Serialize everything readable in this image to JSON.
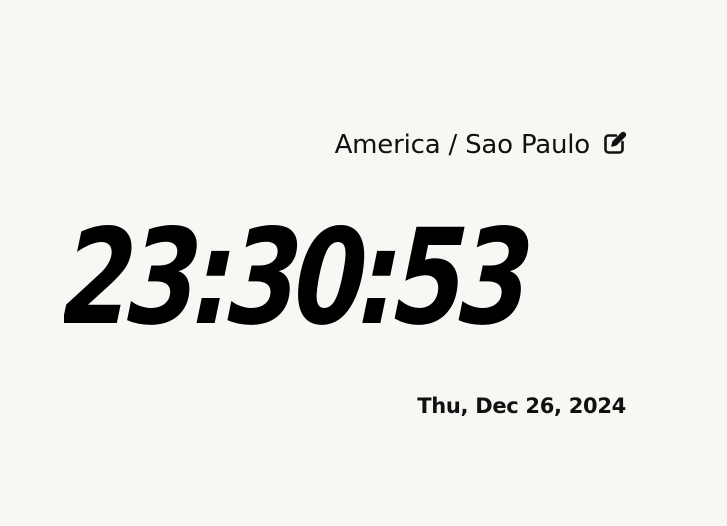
{
  "timezone": {
    "label": "America / Sao Paulo",
    "edit_icon": "edit-icon"
  },
  "clock": {
    "time": "23:30:53",
    "date": "Thu, Dec 26, 2024"
  },
  "colors": {
    "background": "#f8f7f4",
    "text": "#000000"
  }
}
